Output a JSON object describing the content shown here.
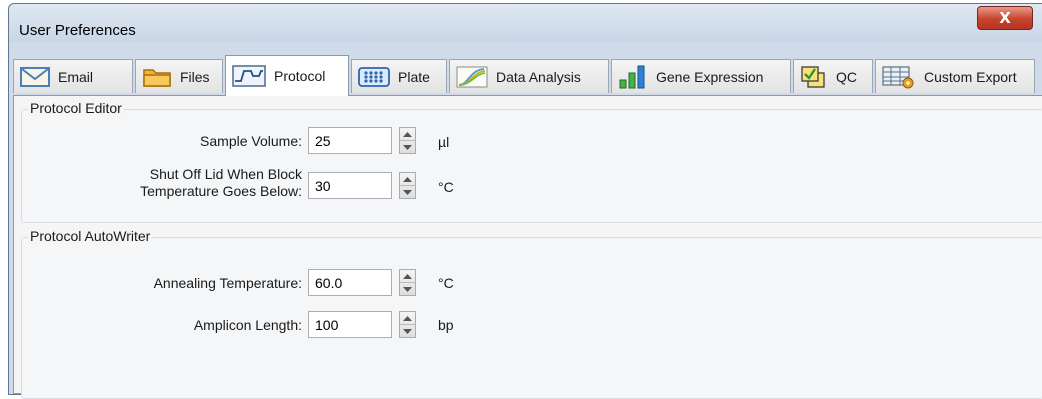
{
  "window": {
    "title": "User Preferences",
    "close_glyph": "X"
  },
  "tabs": [
    {
      "label": "Email",
      "icon": "envelope-icon"
    },
    {
      "label": "Files",
      "icon": "folder-icon"
    },
    {
      "label": "Protocol",
      "icon": "protocol-curve-icon",
      "active": true
    },
    {
      "label": "Plate",
      "icon": "plate-grid-icon"
    },
    {
      "label": "Data Analysis",
      "icon": "amplification-curves-icon"
    },
    {
      "label": "Gene Expression",
      "icon": "bar-chart-icon"
    },
    {
      "label": "QC",
      "icon": "checkbox-stack-icon"
    },
    {
      "label": "Custom Export",
      "icon": "table-export-icon"
    }
  ],
  "protocol_editor": {
    "title": "Protocol Editor",
    "sample_volume_label": "Sample Volume:",
    "sample_volume_value": "25",
    "sample_volume_unit": "µl",
    "lid_label_line1": "Shut Off Lid When Block",
    "lid_label_line2": "Temperature Goes Below:",
    "lid_value": "30",
    "lid_unit": "°C"
  },
  "autowriter": {
    "title": "Protocol AutoWriter",
    "annealing_label": "Annealing Temperature:",
    "annealing_value": "60.0",
    "annealing_unit": "°C",
    "amplicon_label": "Amplicon Length:",
    "amplicon_value": "100",
    "amplicon_unit": "bp"
  },
  "colors": {
    "close_button": "#c7432d",
    "window_frame": "#cfdbe8"
  }
}
